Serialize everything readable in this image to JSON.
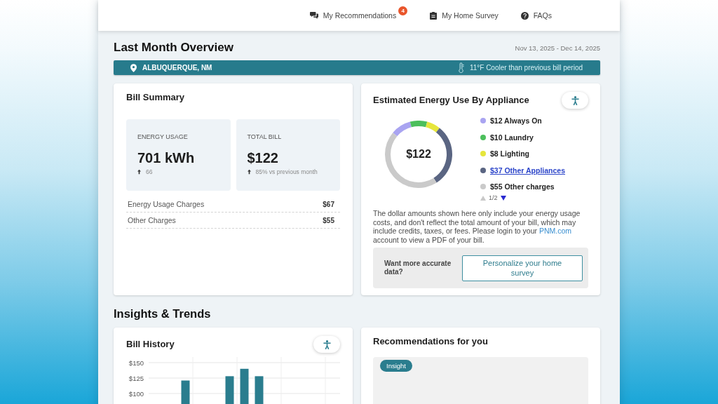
{
  "header": {
    "nav": [
      {
        "label": "My Recommendations",
        "badge": "4"
      },
      {
        "label": "My Home Survey"
      },
      {
        "label": "FAQs"
      }
    ]
  },
  "overview": {
    "title": "Last Month Overview",
    "date_range": "Nov 13, 2025 - Dec 14, 2025",
    "location": "ALBUQUERQUE, NM",
    "weather_note": "11°F Cooler than previous bill period"
  },
  "bill_summary": {
    "title": "Bill Summary",
    "tiles": [
      {
        "label": "ENERGY USAGE",
        "value": "701 kWh",
        "rising": true,
        "change": "66"
      },
      {
        "label": "TOTAL BILL",
        "value": "$122",
        "rising": true,
        "change": "85% vs previous month"
      }
    ],
    "charges": [
      {
        "label": "Energy Usage Charges",
        "amount": "$67"
      },
      {
        "label": "Other Charges",
        "amount": "$55"
      }
    ]
  },
  "appliance_usage": {
    "title": "Estimated Energy Use By Appliance",
    "total": "$122",
    "chart_data": {
      "type": "donut",
      "categories": [
        "Always On",
        "Laundry",
        "Lighting",
        "Other Appliances",
        "Other charges"
      ],
      "values": [
        9.8,
        8.2,
        6.6,
        30.3,
        45.1
      ]
    },
    "legend": [
      {
        "amount": "$12",
        "color": "#a9a4f1",
        "kind": "text"
      },
      {
        "amount": "$10",
        "color": "#4cbf5c",
        "kind": "text"
      },
      {
        "amount": "$8",
        "color": "#e6e63c",
        "kind": "text"
      },
      {
        "amount": "$37",
        "color": "#5a6582",
        "kind": "link"
      },
      {
        "amount": "$55",
        "color": "#cacaca",
        "kind": "text"
      }
    ],
    "pager": {
      "label": "1/2",
      "prev_disabled": true,
      "next_disabled": false
    },
    "note": {
      "text": "The dollar amounts shown here only include your energy usage costs, and don't reflect the total amount of your bill, which may include credits, taxes, or fees. Please login to your ",
      "link": "PNM.com",
      "text_after": " account to view a PDF of your bill."
    },
    "survey_prompt": {
      "text": "Want more accurate data?",
      "button": "Personalize your home survey"
    }
  },
  "insights": {
    "title": "Insights & Trends",
    "bill_history": {
      "title": "Bill History",
      "chart_data": {
        "type": "bar",
        "values": [
          null,
          null,
          121,
          null,
          null,
          128,
          140,
          128,
          null,
          null,
          null,
          null,
          null
        ],
        "ylim": [
          0,
          150
        ],
        "yticks": [
          {
            "value": 100,
            "label": "$100"
          },
          {
            "value": 125,
            "label": "$125"
          },
          {
            "value": 150,
            "label": "$150"
          }
        ]
      }
    },
    "recommendations": {
      "title": "Recommendations for you",
      "cards": [
        {
          "tag": "Insight"
        }
      ]
    }
  }
}
